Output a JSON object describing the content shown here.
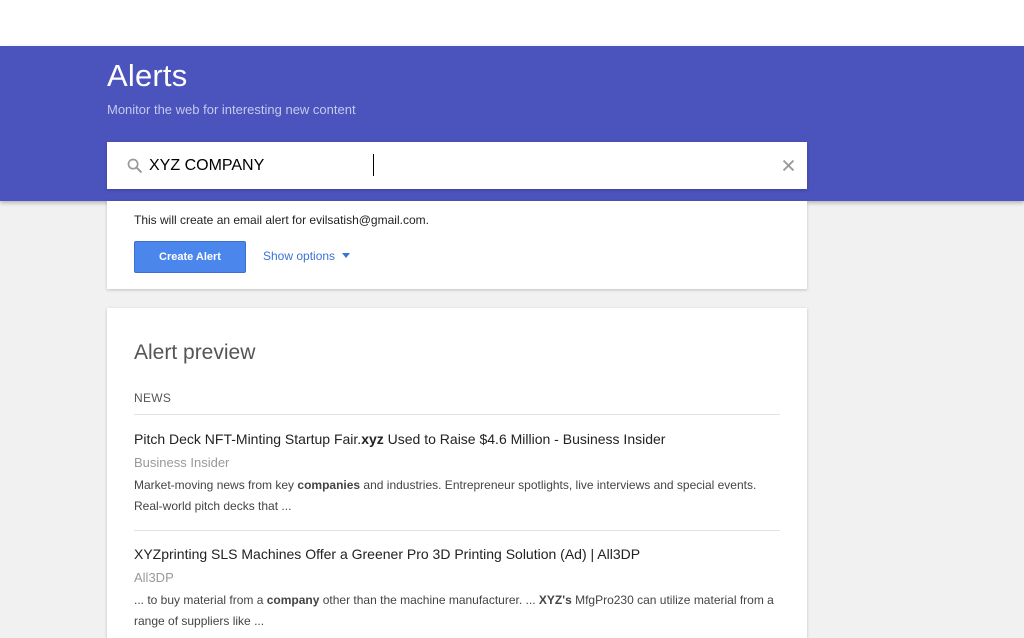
{
  "header": {
    "title": "Alerts",
    "subtitle": "Monitor the web for interesting new content"
  },
  "search": {
    "value": "XYZ COMPANY",
    "icon": "search-icon",
    "clear_icon": "close-icon"
  },
  "create": {
    "email_note": "This will create an email alert for evilsatish@gmail.com.",
    "button_label": "Create Alert",
    "options_label": "Show options"
  },
  "preview": {
    "title": "Alert preview",
    "section": "NEWS",
    "items": [
      {
        "title_prefix": "Pitch Deck NFT-Minting Startup Fair.",
        "title_bold": "xyz",
        "title_suffix": " Used to Raise $4.6 Million - Business Insider",
        "source": "Business Insider",
        "snippet_1": "Market-moving news from key ",
        "snippet_bold_1": "companies",
        "snippet_2": " and industries. Entrepreneur spotlights, live interviews and special events. Real-world pitch decks that ..."
      },
      {
        "title": "XYZprinting SLS Machines Offer a Greener Pro 3D Printing Solution (Ad) | All3DP",
        "source": "All3DP",
        "snippet_1": "... to buy material from a ",
        "snippet_bold_1": "company",
        "snippet_2": " other than the machine manufacturer. ... ",
        "snippet_bold_2": "XYZ's",
        "snippet_3": " MfgPro230 can utilize material from a range of suppliers like ..."
      }
    ]
  },
  "colors": {
    "header_bg": "#4b53bc",
    "accent_button": "#4a86ec",
    "link": "#3b73d6",
    "page_bg": "#f1f1f1"
  }
}
